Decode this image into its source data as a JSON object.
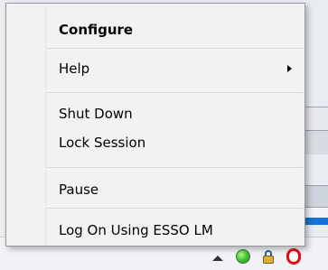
{
  "context_menu": {
    "items": [
      {
        "label": "Configure",
        "bold": true
      },
      {
        "label": "Help",
        "submenu": true
      },
      {
        "label": "Shut Down"
      },
      {
        "label": "Lock Session"
      },
      {
        "label": "Pause"
      },
      {
        "label": "Log On Using ESSO LM"
      }
    ]
  },
  "tray": {
    "icons": [
      {
        "name": "show-hidden-icons-chevron-icon"
      },
      {
        "name": "green-status-icon"
      },
      {
        "name": "lock-icon"
      },
      {
        "name": "red-app-icon"
      }
    ]
  },
  "colors": {
    "menu_bg": "#f2f2f2",
    "menu_border": "#979797",
    "separator": "#d6d6d6",
    "taskbar_bg": "#f0f2f5",
    "accent_blue": "#1673d6",
    "tray_red": "#e10a17",
    "tray_green": "#4bc73a"
  }
}
